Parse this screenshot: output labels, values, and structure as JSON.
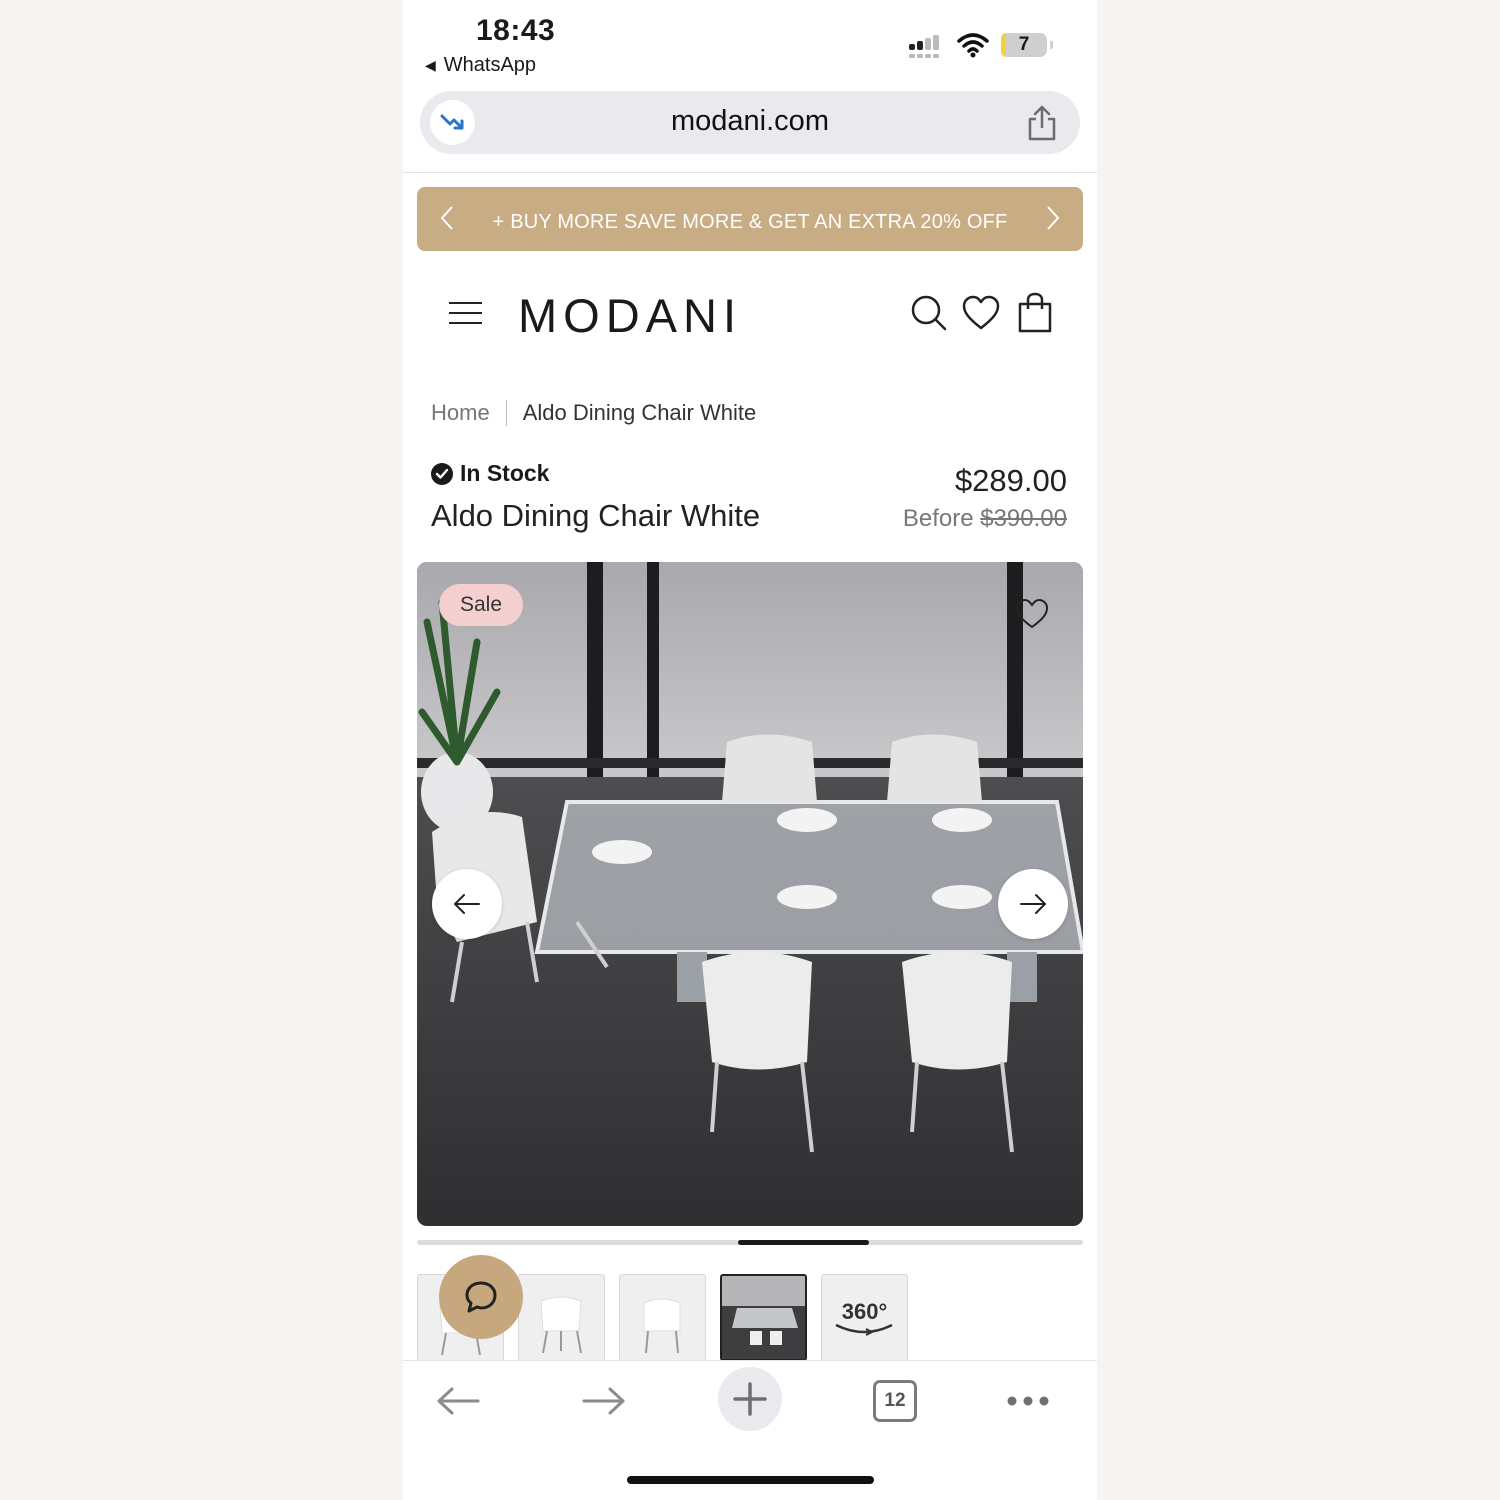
{
  "status_bar": {
    "time": "18:43",
    "back_app": "WhatsApp",
    "battery": "7"
  },
  "browser": {
    "url": "modani.com",
    "tab_count": "12"
  },
  "promo": {
    "text": "+ BUY MORE SAVE MORE & GET AN EXTRA 20% OFF",
    "background": "#c8ac84"
  },
  "header": {
    "logo": "MODANI"
  },
  "breadcrumb": {
    "home": "Home",
    "current": "Aldo Dining Chair White"
  },
  "product": {
    "stock": "In Stock",
    "title": "Aldo Dining Chair White",
    "price": "$289.00",
    "before_label": "Before",
    "before_price": "$390.00",
    "badge": "Sale"
  },
  "gallery": {
    "thumbnail_count": 5,
    "active_thumbnail": 4,
    "three60_label": "360°",
    "scroll_position": 0.6
  },
  "colors": {
    "accent": "#c8ac84",
    "sale_badge": "#f4cfd0",
    "chat_button": "#c6a77e"
  }
}
